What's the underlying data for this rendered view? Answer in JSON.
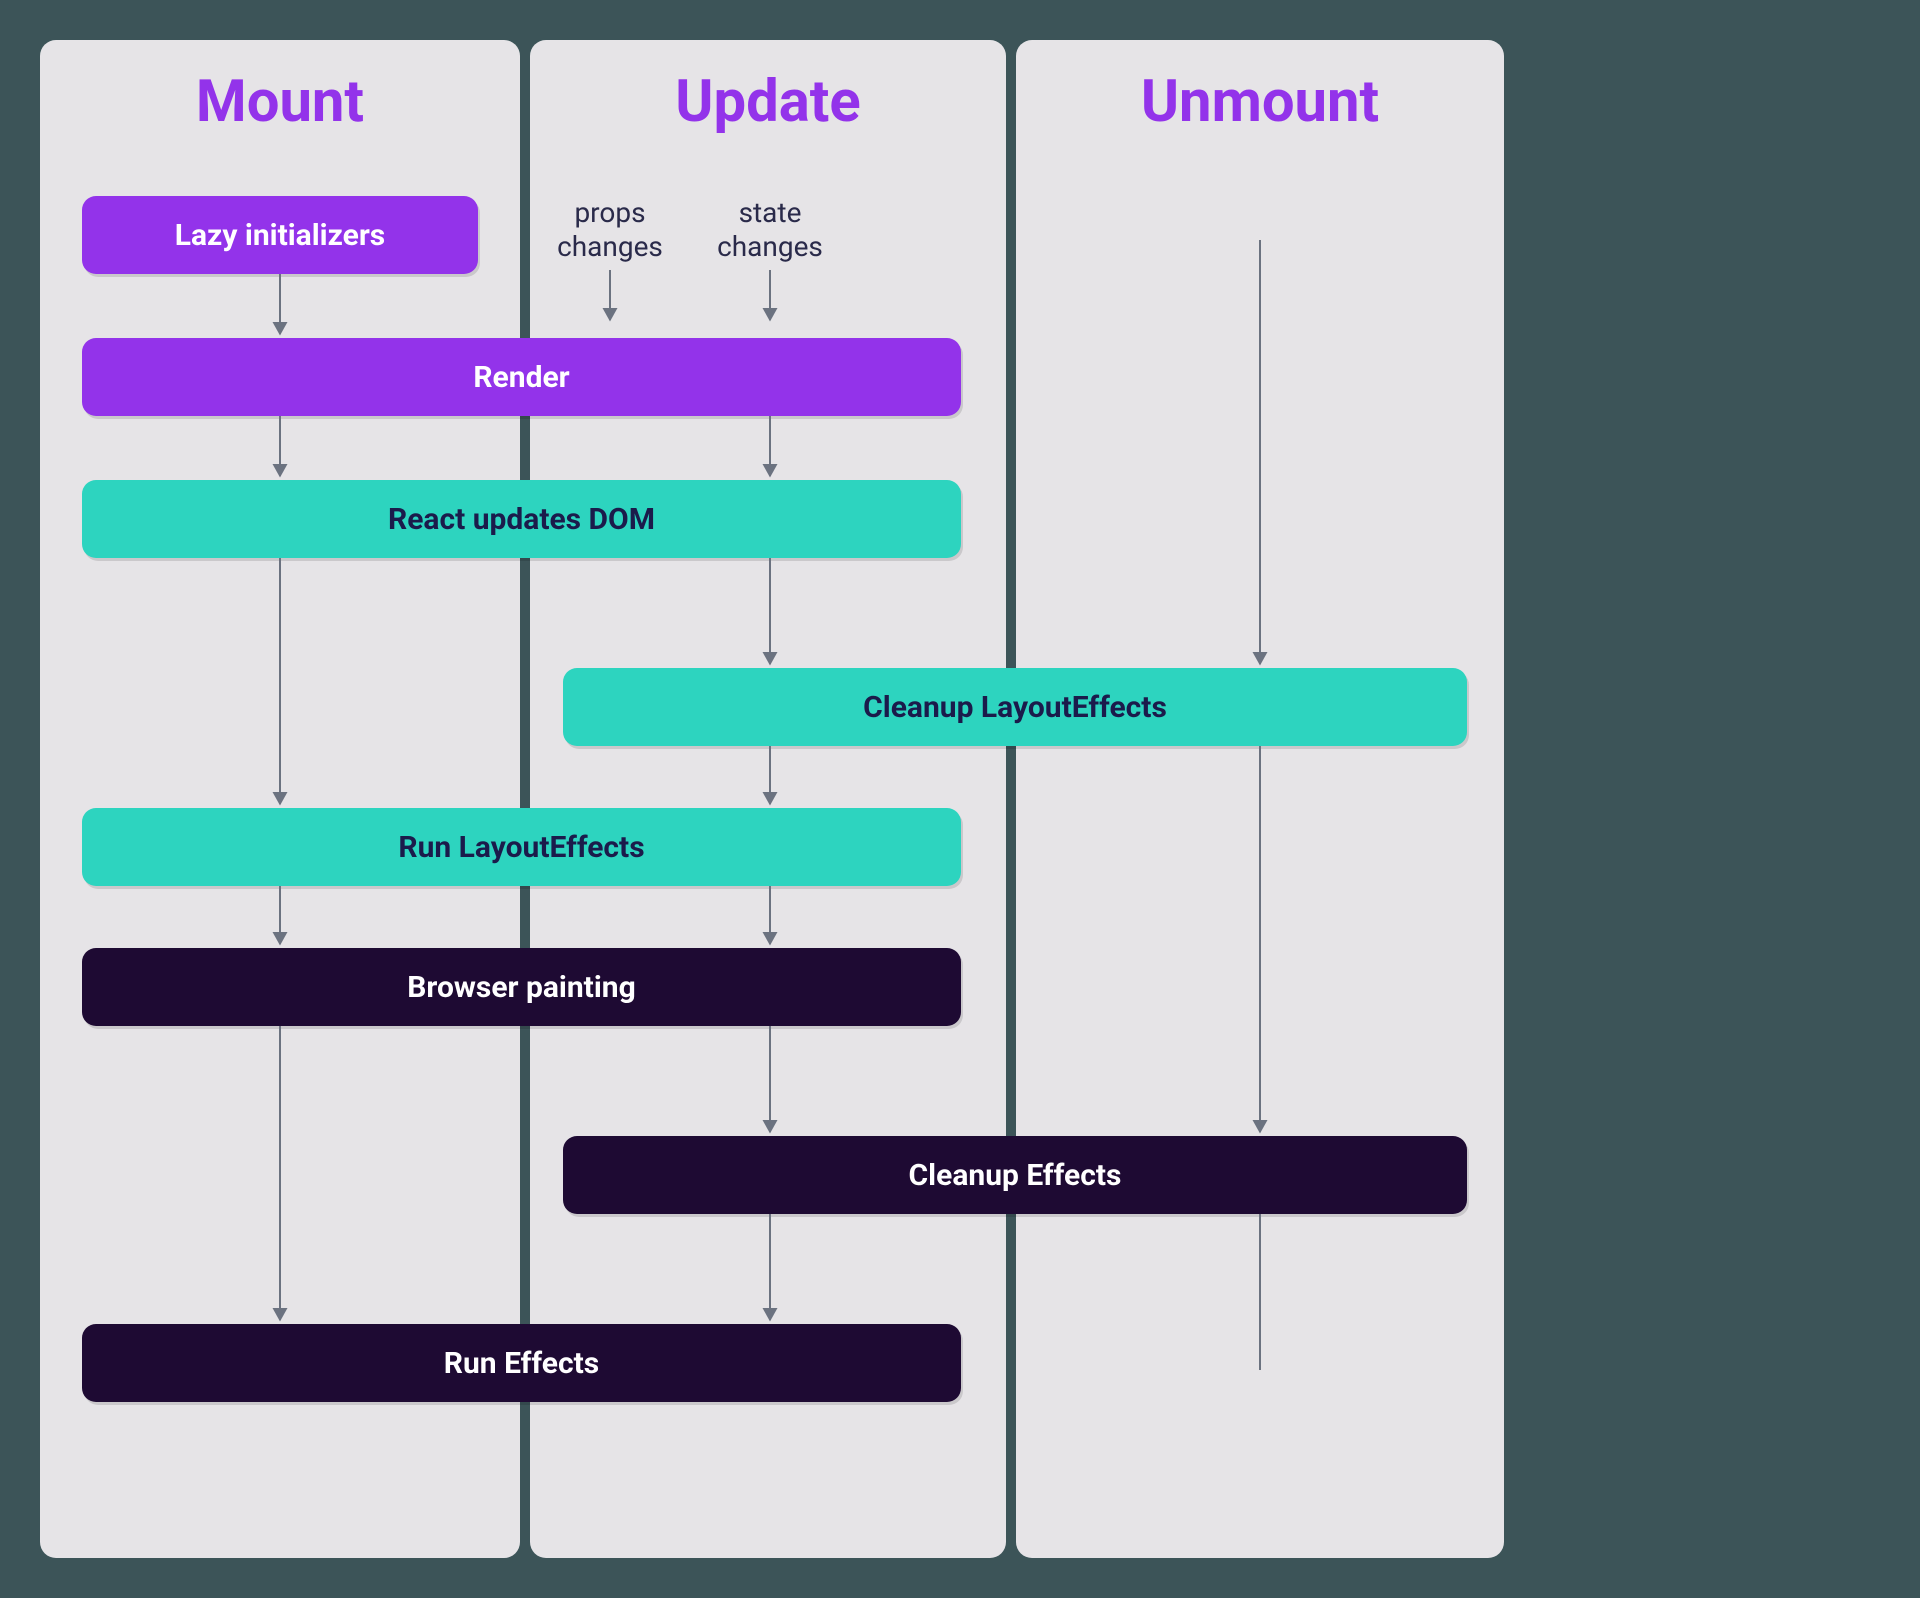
{
  "columns": {
    "mount": "Mount",
    "update": "Update",
    "unmount": "Unmount"
  },
  "triggers": {
    "props": "props changes",
    "state": "state changes"
  },
  "boxes": {
    "lazy": "Lazy initializers",
    "render": "Render",
    "dom": "React updates DOM",
    "cleanup_layout": "Cleanup LayoutEffects",
    "run_layout": "Run LayoutEffects",
    "paint": "Browser painting",
    "cleanup_effects": "Cleanup Effects",
    "run_effects": "Run Effects"
  },
  "colors": {
    "bg": "#3c5458",
    "panel": "#e6e4e7",
    "heading": "#9333ea",
    "purple": "#9333ea",
    "teal": "#2dd4bf",
    "dark": "#1e0a33"
  }
}
